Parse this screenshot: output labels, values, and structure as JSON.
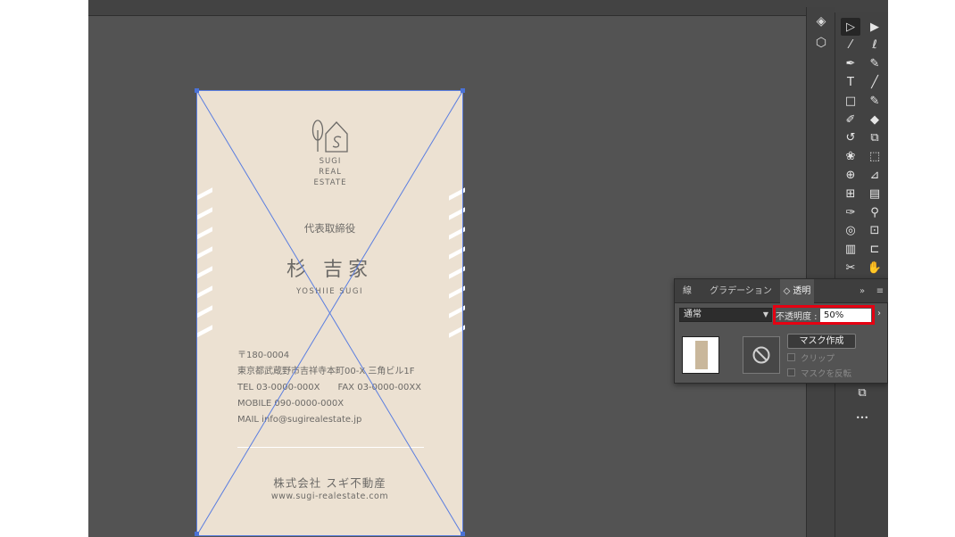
{
  "card": {
    "logo_line1": "SUGI",
    "logo_line2": "REAL",
    "logo_line3": "ESTATE",
    "job_title": "代表取締役",
    "name": "杉 吉家",
    "name_romaji": "YOSHIIE SUGI",
    "address_lines": [
      "〒180-0004",
      "東京都武蔵野市吉祥寺本町00-X 三角ビル1F",
      "TEL 03-0000-000X　　FAX 03-0000-00XX",
      "MOBILE 090-0000-000X",
      "MAIL info@sugirealestate.jp"
    ],
    "company": "株式会社 スギ不動産",
    "url": "www.sugi-realestate.com"
  },
  "panel": {
    "tabs": [
      {
        "label": "線"
      },
      {
        "label": "グラデーション"
      },
      {
        "label": "◇ 透明"
      }
    ],
    "tab_overflow": "»",
    "menu_icon": "≡",
    "blend_mode": "通常",
    "opacity_label": "不透明度 :",
    "opacity_value": "50%",
    "opacity_more": "›",
    "make_mask_label": "マスク作成",
    "clip_label": "クリップ",
    "invert_mask_label": "マスクを反転"
  },
  "toolbar": {
    "tools": [
      {
        "icon": "selection-tool-icon",
        "glyph": "▷"
      },
      {
        "icon": "direct-selection-tool-icon",
        "glyph": "▶"
      },
      {
        "icon": "magic-wand-tool-icon",
        "glyph": "⁄"
      },
      {
        "icon": "lasso-tool-icon",
        "glyph": "ℓ"
      },
      {
        "icon": "pen-tool-icon",
        "glyph": "✒"
      },
      {
        "icon": "curvature-tool-icon",
        "glyph": "✎"
      },
      {
        "icon": "type-tool-icon",
        "glyph": "T"
      },
      {
        "icon": "line-tool-icon",
        "glyph": "╱"
      },
      {
        "icon": "rectangle-tool-icon",
        "glyph": "□"
      },
      {
        "icon": "paintbrush-tool-icon",
        "glyph": "✎"
      },
      {
        "icon": "shaper-tool-icon",
        "glyph": "✐"
      },
      {
        "icon": "eraser-tool-icon",
        "glyph": "◆"
      },
      {
        "icon": "rotate-tool-icon",
        "glyph": "↺"
      },
      {
        "icon": "scale-tool-icon",
        "glyph": "⧉"
      },
      {
        "icon": "warp-tool-icon",
        "glyph": "❀"
      },
      {
        "icon": "free-transform-tool-icon",
        "glyph": "⬚"
      },
      {
        "icon": "shape-builder-tool-icon",
        "glyph": "⊕"
      },
      {
        "icon": "perspective-grid-tool-icon",
        "glyph": "⊿"
      },
      {
        "icon": "mesh-tool-icon",
        "glyph": "⊞"
      },
      {
        "icon": "gradient-tool-icon",
        "glyph": "▤"
      },
      {
        "icon": "eyedropper-tool-icon",
        "glyph": "✑"
      },
      {
        "icon": "measure-tool-icon",
        "glyph": "⚲"
      },
      {
        "icon": "blend-tool-icon",
        "glyph": "◎"
      },
      {
        "icon": "symbol-sprayer-tool-icon",
        "glyph": "⊡"
      },
      {
        "icon": "column-graph-tool-icon",
        "glyph": "▥"
      },
      {
        "icon": "artboard-tool-icon",
        "glyph": "⊏"
      },
      {
        "icon": "slice-tool-icon",
        "glyph": "✂"
      },
      {
        "icon": "hand-tool-icon",
        "glyph": "✋"
      }
    ],
    "more_glyph": "•••",
    "screen_mode_glyph": "⧉"
  },
  "dock": {
    "layers_glyph": "◈",
    "libraries_glyph": "⬡"
  }
}
